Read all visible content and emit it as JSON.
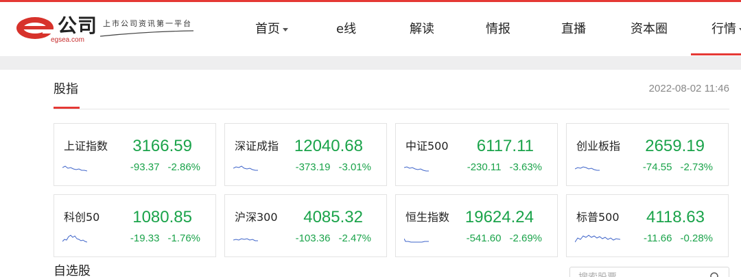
{
  "brand": {
    "cn_name": "公司",
    "slogan": "上市公司资讯第一平台",
    "domain": "egsea.com",
    "accent_color": "#e53935"
  },
  "nav": {
    "items": [
      {
        "label": "首页",
        "has_dropdown": true
      },
      {
        "label": "e线"
      },
      {
        "label": "解读"
      },
      {
        "label": "情报"
      },
      {
        "label": "直播"
      },
      {
        "label": "资本圈"
      },
      {
        "label": "行情",
        "has_dropdown": true,
        "active": true
      }
    ]
  },
  "indices_section": {
    "title": "股指",
    "timestamp": "2022-08-02 11:46"
  },
  "indices": [
    {
      "name": "上证指数",
      "value": "3166.59",
      "change": "-93.37",
      "percent": "-2.86%",
      "trend": "down",
      "color": "#1aa34a"
    },
    {
      "name": "深证成指",
      "value": "12040.68",
      "change": "-373.19",
      "percent": "-3.01%",
      "trend": "down",
      "color": "#1aa34a"
    },
    {
      "name": "中证500",
      "value": "6117.11",
      "change": "-230.11",
      "percent": "-3.63%",
      "trend": "down",
      "color": "#1aa34a"
    },
    {
      "name": "创业板指",
      "value": "2659.19",
      "change": "-74.55",
      "percent": "-2.73%",
      "trend": "down",
      "color": "#1aa34a"
    },
    {
      "name": "科创50",
      "value": "1080.85",
      "change": "-19.33",
      "percent": "-1.76%",
      "trend": "down",
      "color": "#1aa34a"
    },
    {
      "name": "沪深300",
      "value": "4085.32",
      "change": "-103.36",
      "percent": "-2.47%",
      "trend": "down",
      "color": "#1aa34a"
    },
    {
      "name": "恒生指数",
      "value": "19624.24",
      "change": "-541.60",
      "percent": "-2.69%",
      "trend": "down",
      "color": "#1aa34a"
    },
    {
      "name": "标普500",
      "value": "4118.63",
      "change": "-11.66",
      "percent": "-0.28%",
      "trend": "down",
      "color": "#1aa34a"
    }
  ],
  "watchlist_section": {
    "title": "自选股",
    "search_placeholder": "搜索股票"
  }
}
